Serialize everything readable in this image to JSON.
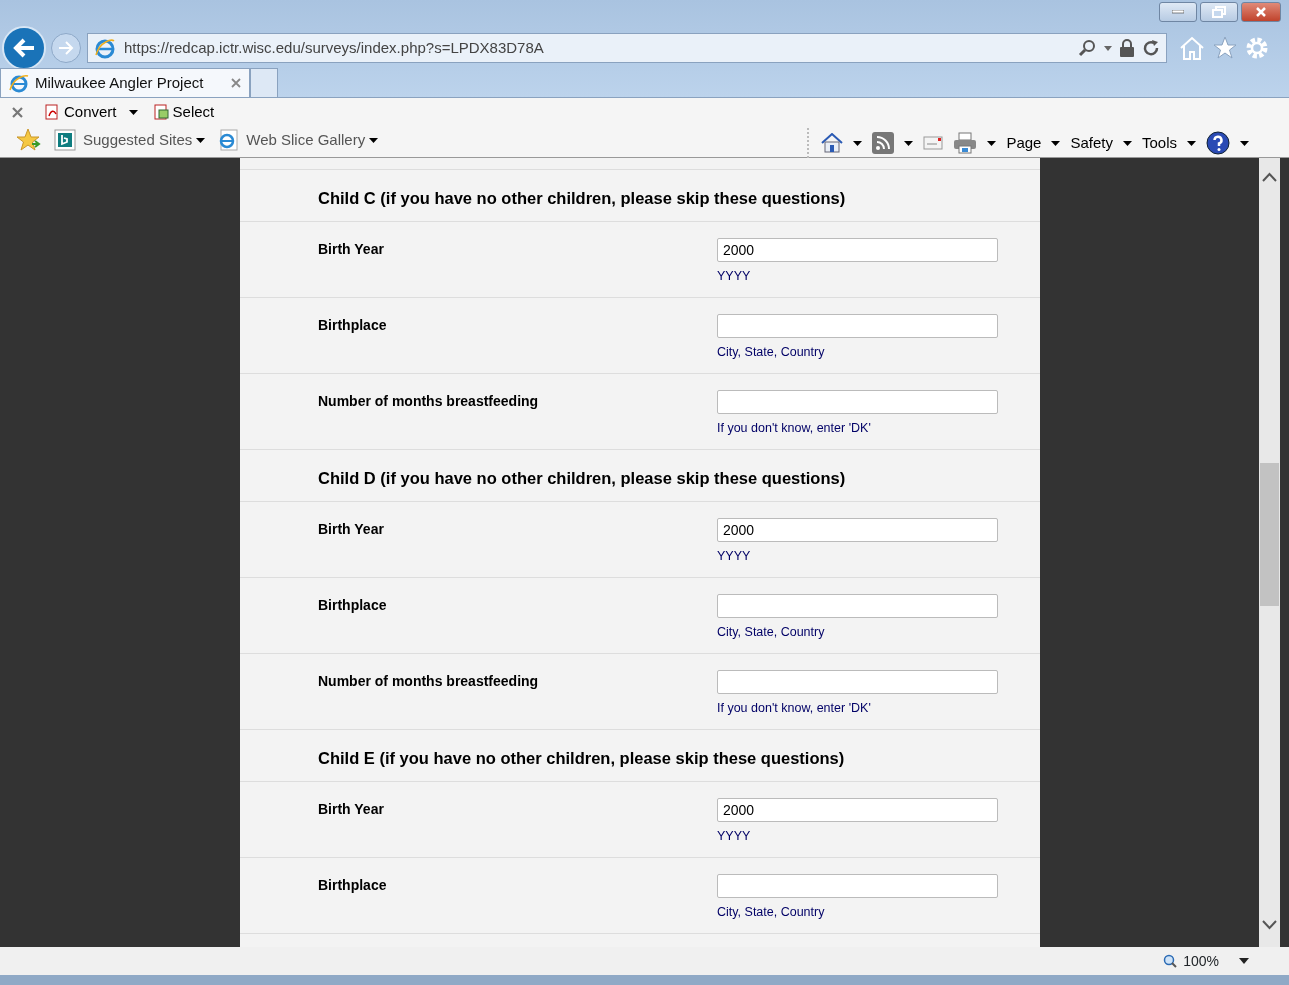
{
  "browser": {
    "url": "https://redcap.ictr.wisc.edu/surveys/index.php?s=LPDX83D78A",
    "tab_title": "Milwaukee Angler Project",
    "command_bar": [
      {
        "label": "Convert",
        "dropdown": true,
        "kind": "pdf"
      },
      {
        "label": "Select",
        "dropdown": false,
        "kind": "select"
      }
    ],
    "favorites": [
      {
        "label": "Suggested Sites",
        "kind": "bing"
      },
      {
        "label": "Web Slice Gallery",
        "kind": "ie"
      }
    ],
    "menus": [
      {
        "label": "Page"
      },
      {
        "label": "Safety"
      },
      {
        "label": "Tools"
      }
    ],
    "zoom": "100%"
  },
  "sections": [
    {
      "title": "Child C (if you have no other children, please skip these questions)",
      "fields": [
        {
          "label": "Birth Year",
          "value": "2000",
          "hint": "YYYY"
        },
        {
          "label": "Birthplace",
          "hint": "City, State, Country"
        },
        {
          "label": "Number of months breastfeeding",
          "hint": "If you don't know, enter 'DK'"
        }
      ]
    },
    {
      "title": "Child D (if you have no other children, please skip these questions)",
      "fields": [
        {
          "label": "Birth Year",
          "value": "2000",
          "hint": "YYYY"
        },
        {
          "label": "Birthplace",
          "hint": "City, State, Country"
        },
        {
          "label": "Number of months breastfeeding",
          "hint": "If you don't know, enter 'DK'"
        }
      ]
    },
    {
      "title": "Child E (if you have no other children, please skip these questions)",
      "fields": [
        {
          "label": "Birth Year",
          "value": "2000",
          "hint": "YYYY"
        },
        {
          "label": "Birthplace",
          "hint": "City, State, Country"
        }
      ]
    }
  ]
}
